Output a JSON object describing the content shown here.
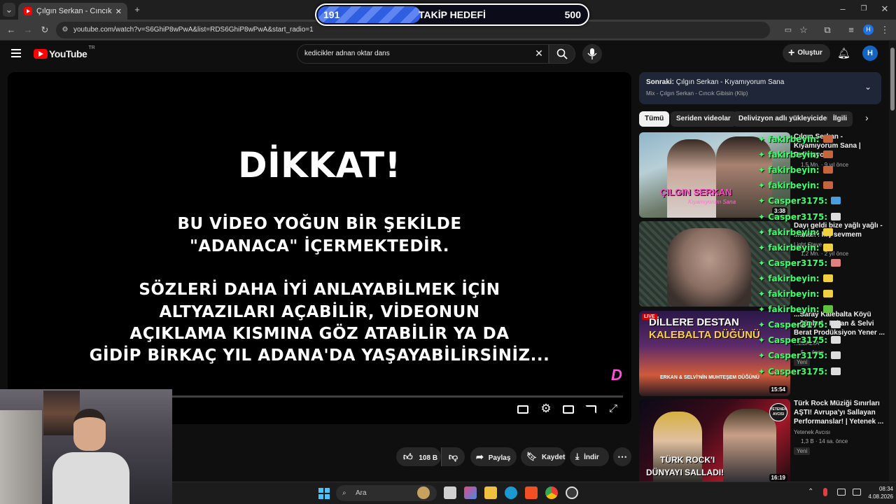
{
  "browser": {
    "tab_title": "Çılgın Serkan - Cıncık Gibisin (K",
    "url": "youtube.com/watch?v=S6GhiP8wPwA&list=RDS6GhiP8wPwA&start_radio=1",
    "profile_initial": "H"
  },
  "overlay_goal": {
    "current": "191",
    "label": "TAKİP HEDEFİ",
    "target": "500",
    "progress_fraction": 0.382
  },
  "youtube": {
    "logo_text": "YouTube",
    "region": "TR",
    "search_value": "kedicikler adnan oktar dans",
    "create_label": "Oluştur",
    "avatar_initial": "H"
  },
  "player": {
    "heading": "DİKKAT!",
    "line1": "BU VİDEO YOĞUN BİR ŞEKİLDE",
    "line2": "\"ADANACA\" İÇERMEKTEDİR.",
    "line3": "SÖZLERİ DAHA İYİ ANLAYABİLMEK İÇİN",
    "line4": "ALTYAZILARI AÇABİLİR, VİDEONUN",
    "line5": "AÇIKLAMA KISMINA GÖZ ATABİLİR YA DA",
    "line6": "GİDİP BİRKAÇ YIL ADANA'DA YAŞAYABİLİRSİNİZ...",
    "watermark": "D"
  },
  "actions": {
    "like_count": "108 B",
    "share": "Paylaş",
    "save": "Kaydet",
    "download": "İndir"
  },
  "playlist": {
    "next_prefix": "Sonraki:",
    "next_title": "Çılgın Serkan - Kıyamıyorum Sana",
    "subtitle": "Mix - Çılgın Serkan - Cıncık Gibisin (Klip)"
  },
  "chips": [
    "Tümü",
    "Seriden videolar",
    "Delivizyon adlı yükleyiciden",
    "İlgili"
  ],
  "videos": [
    {
      "title": "Çılgın Serkan - Kıyamıyorum Sana | Delivizyon",
      "channel": "",
      "meta": "1,5 Mn. · 9 yıl önce",
      "duration": "3:38",
      "thumb_text1": "ÇILGIN SERKAN",
      "thumb_text2": "Kıyamıyorum Sana"
    },
    {
      "title": "Dayı geldi bize yağlı yağlı - ...adan'ı hiç sevmem",
      "channel": "Light Stave",
      "meta": "1,2 Mn. · 2 yıl önce",
      "duration": ""
    },
    {
      "title": "...Saray Kalebalta Köyü ...ğünleri - Erkan & Selvi Berat Prodüksiyon Yener ...",
      "channel": "...EBALTA",
      "meta": "5 ... önce",
      "duration": "15:54",
      "badge": "Yeni",
      "thumb_text1": "DİLLERE DESTAN",
      "thumb_text2": "KALEBALTA DÜĞÜNÜ",
      "live": "LIVE",
      "thumb_text3": "ERKAN & SELVİ'NİN MUHTEŞEM DÜĞÜNÜ"
    },
    {
      "title": "Türk Rock Müziği Sınırları AŞTI! Avrupa'yı Sallayan Performanslar! | Yetenek ...",
      "channel": "Yetenek Avcısı",
      "meta": "1,3 B · 14 sa. önce",
      "duration": "16:19",
      "badge": "Yeni",
      "thumb_text1": "TÜRK ROCK'I",
      "thumb_text2": "DÜNYAYI SALLADI!",
      "thumb_badge": "YETENEK AVCISI"
    }
  ],
  "chat": [
    {
      "user": "fakirbeyin:",
      "emote": "#c8643c"
    },
    {
      "user": "fakirbeyin:",
      "emote": "#c8643c"
    },
    {
      "user": "fakirbeyin:",
      "emote": "#c8643c"
    },
    {
      "user": "fakirbeyin:",
      "emote": "#c8643c"
    },
    {
      "user": "Casper3175:",
      "emote": "#4a9ee0"
    },
    {
      "user": "Casper3175:",
      "emote": "#dddddd"
    },
    {
      "user": "fakirbeyin:",
      "emote": "#f0d040"
    },
    {
      "user": "fakirbeyin:",
      "emote": "#f0d040"
    },
    {
      "user": "Casper3175:",
      "emote": "#e08080"
    },
    {
      "user": "fakirbeyin:",
      "emote": "#f0d040"
    },
    {
      "user": "fakirbeyin:",
      "emote": "#f0d040"
    },
    {
      "user": "fakirbeyin:",
      "emote": "#60c040"
    },
    {
      "user": "Casper3175:",
      "emote": "#dddddd"
    },
    {
      "user": "Casper3175:",
      "emote": "#dddddd"
    },
    {
      "user": "Casper3175:",
      "emote": "#dddddd"
    },
    {
      "user": "Casper3175:",
      "emote": "#dddddd"
    }
  ],
  "taskbar": {
    "search_placeholder": "Ara",
    "time": "08:34",
    "date": "4.08.2026"
  }
}
